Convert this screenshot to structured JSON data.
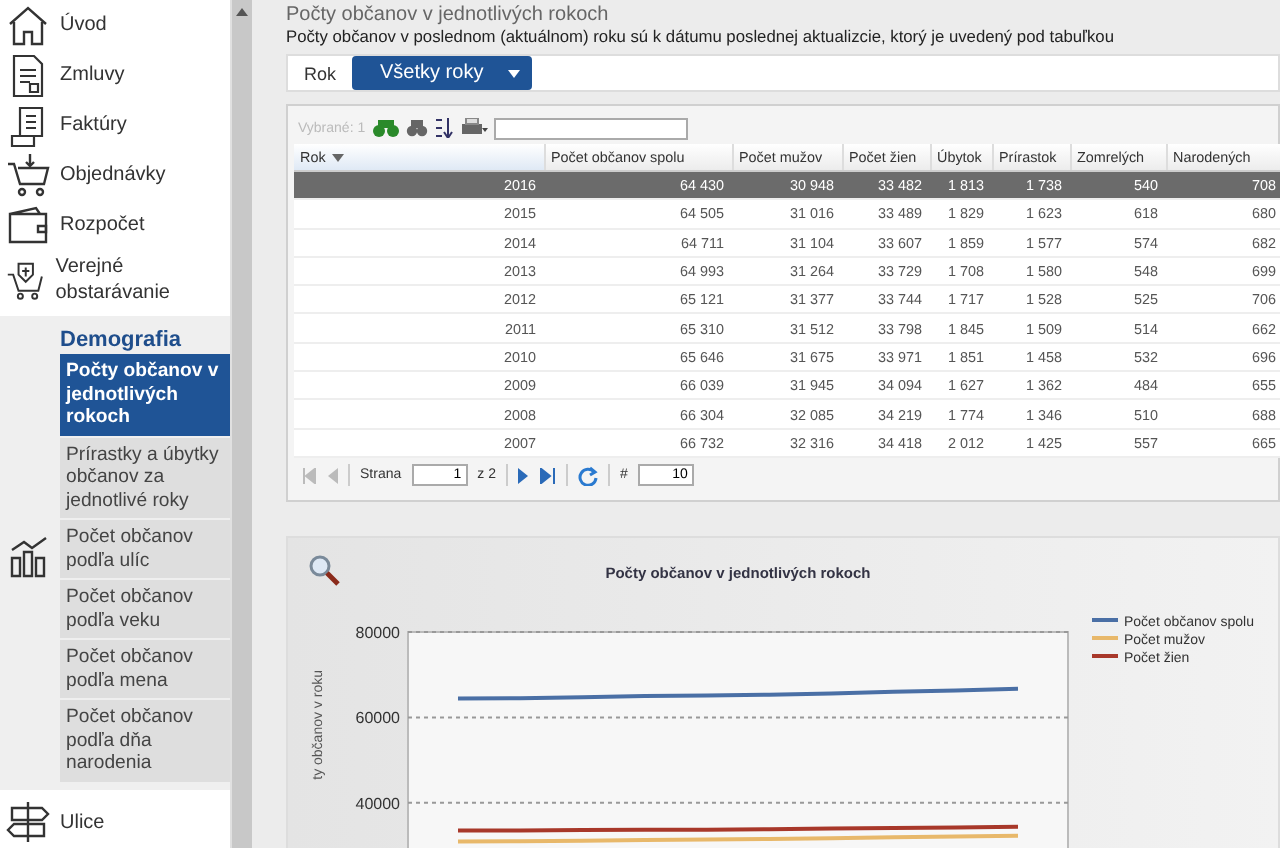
{
  "sidebar": {
    "items": [
      {
        "label": "Úvod"
      },
      {
        "label": "Zmluvy"
      },
      {
        "label": "Faktúry"
      },
      {
        "label": "Objednávky"
      },
      {
        "label": "Rozpočet"
      },
      {
        "label": "Verejné obstarávanie"
      }
    ],
    "section": {
      "title": "Demografia",
      "items": [
        {
          "label": "Počty občanov v jednotlivých rokoch",
          "selected": true
        },
        {
          "label": "Prírastky a úbytky občanov za jednotlivé roky",
          "selected": false
        },
        {
          "label": "Počet občanov podľa ulíc",
          "selected": false
        },
        {
          "label": "Počet občanov podľa veku",
          "selected": false
        },
        {
          "label": "Počet občanov podľa mena",
          "selected": false
        },
        {
          "label": "Počet občanov podľa dňa narodenia",
          "selected": false
        }
      ]
    },
    "bottom_items": [
      {
        "label": "Ulice"
      }
    ]
  },
  "title": "Počty občanov v jednotlivých rokoch",
  "subtitle": "Počty občanov v poslednom (aktuálnom) roku sú k dátumu poslednej aktualizcie, ktorý je uvedený pod tabuľkou",
  "filter": {
    "label": "Rok",
    "value": "Všetky roky"
  },
  "grid": {
    "selected_count": "Vybrané: 1",
    "columns": [
      "Rok",
      "Počet občanov spolu",
      "Počet mužov",
      "Počet žien",
      "Úbytok",
      "Prírastok",
      "Zomrelých",
      "Narodených"
    ],
    "rows": [
      {
        "selected": true,
        "cells": [
          "2016",
          "64 430",
          "30 948",
          "33 482",
          "1 813",
          "1 738",
          "540",
          "708"
        ]
      },
      {
        "selected": false,
        "cells": [
          "2015",
          "64 505",
          "31 016",
          "33 489",
          "1 829",
          "1 623",
          "618",
          "680"
        ]
      },
      {
        "selected": false,
        "cells": [
          "2014",
          "64 711",
          "31 104",
          "33 607",
          "1 859",
          "1 577",
          "574",
          "682"
        ]
      },
      {
        "selected": false,
        "cells": [
          "2013",
          "64 993",
          "31 264",
          "33 729",
          "1 708",
          "1 580",
          "548",
          "699"
        ]
      },
      {
        "selected": false,
        "cells": [
          "2012",
          "65 121",
          "31 377",
          "33 744",
          "1 717",
          "1 528",
          "525",
          "706"
        ]
      },
      {
        "selected": false,
        "cells": [
          "2011",
          "65 310",
          "31 512",
          "33 798",
          "1 845",
          "1 509",
          "514",
          "662"
        ]
      },
      {
        "selected": false,
        "cells": [
          "2010",
          "65 646",
          "31 675",
          "33 971",
          "1 851",
          "1 458",
          "532",
          "696"
        ]
      },
      {
        "selected": false,
        "cells": [
          "2009",
          "66 039",
          "31 945",
          "34 094",
          "1 627",
          "1 362",
          "484",
          "655"
        ]
      },
      {
        "selected": false,
        "cells": [
          "2008",
          "66 304",
          "32 085",
          "34 219",
          "1 774",
          "1 346",
          "510",
          "688"
        ]
      },
      {
        "selected": false,
        "cells": [
          "2007",
          "66 732",
          "32 316",
          "34 418",
          "2 012",
          "1 425",
          "557",
          "665"
        ]
      }
    ],
    "pager": {
      "page_label": "Strana",
      "page": "1",
      "of": "z 2",
      "size_label": "#",
      "size": "10"
    }
  },
  "chart": {
    "chart_data": {
      "type": "line",
      "title": "Počty občanov v jednotlivých rokoch",
      "ylabel": "ty občanov v roku",
      "ylim": [
        28000,
        80000
      ],
      "yticks": [
        40000,
        60000,
        80000
      ],
      "legend": "right",
      "series": [
        {
          "name": "Počet občanov spolu",
          "color": "#4a6fa5",
          "values": [
            64400,
            64500,
            64700,
            65000,
            65100,
            65300,
            65600,
            66000,
            66300,
            66700
          ]
        },
        {
          "name": "Počet mužov",
          "color": "#e8b86a",
          "values": [
            30900,
            31000,
            31100,
            31300,
            31400,
            31500,
            31700,
            31900,
            32100,
            32300
          ]
        },
        {
          "name": "Počet žien",
          "color": "#a8382a",
          "values": [
            33500,
            33500,
            33600,
            33700,
            33700,
            33800,
            34000,
            34100,
            34200,
            34400
          ]
        }
      ]
    }
  }
}
